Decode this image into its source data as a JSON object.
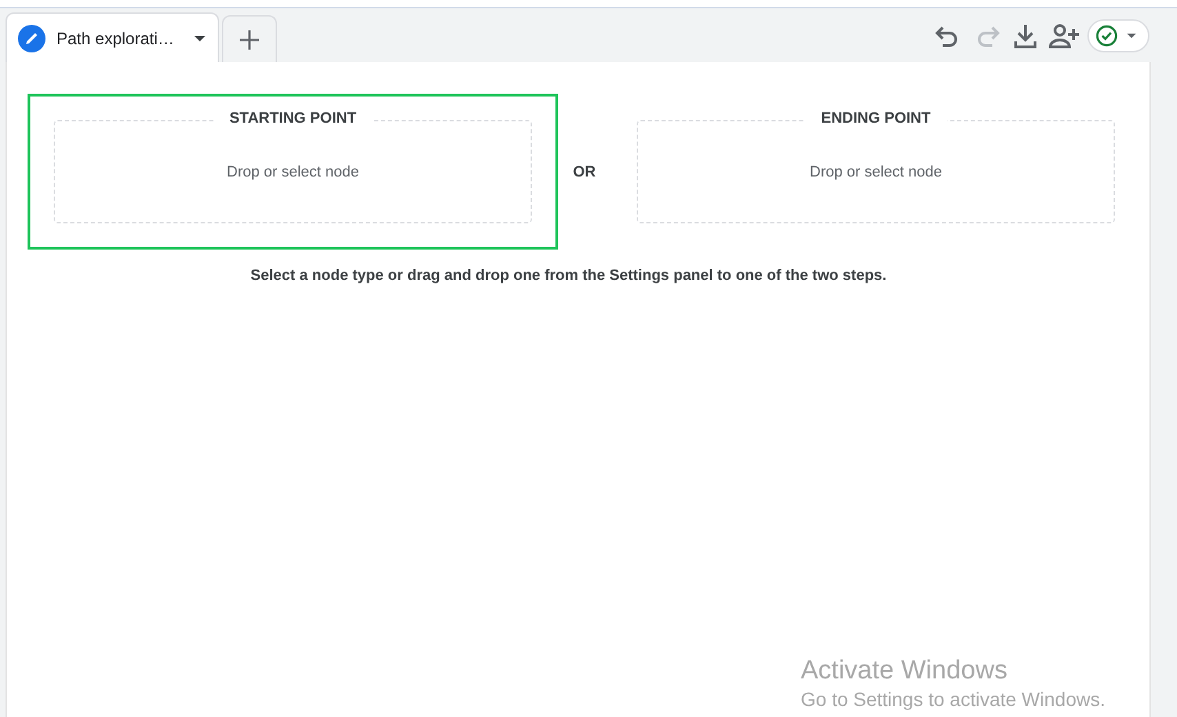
{
  "tabs": [
    {
      "label": "Path explorati…",
      "selected": true
    }
  ],
  "toolbar": [
    {
      "kind": "undo",
      "disabled": false
    },
    {
      "kind": "redo",
      "disabled": true
    },
    {
      "kind": "download",
      "disabled": false
    },
    {
      "kind": "share",
      "disabled": false
    }
  ],
  "steps": [
    {
      "title": "STARTING POINT",
      "placeholder": "Drop or select node",
      "selected": true
    },
    {
      "title": "ENDING POINT",
      "placeholder": "Drop or select node",
      "selected": false
    }
  ],
  "connector": "OR",
  "instruction": "Select a node type or drag and drop one from the Settings panel to one of the two steps.",
  "watermark": {
    "title": "Activate Windows",
    "subtitle": "Go to Settings to activate Windows."
  }
}
